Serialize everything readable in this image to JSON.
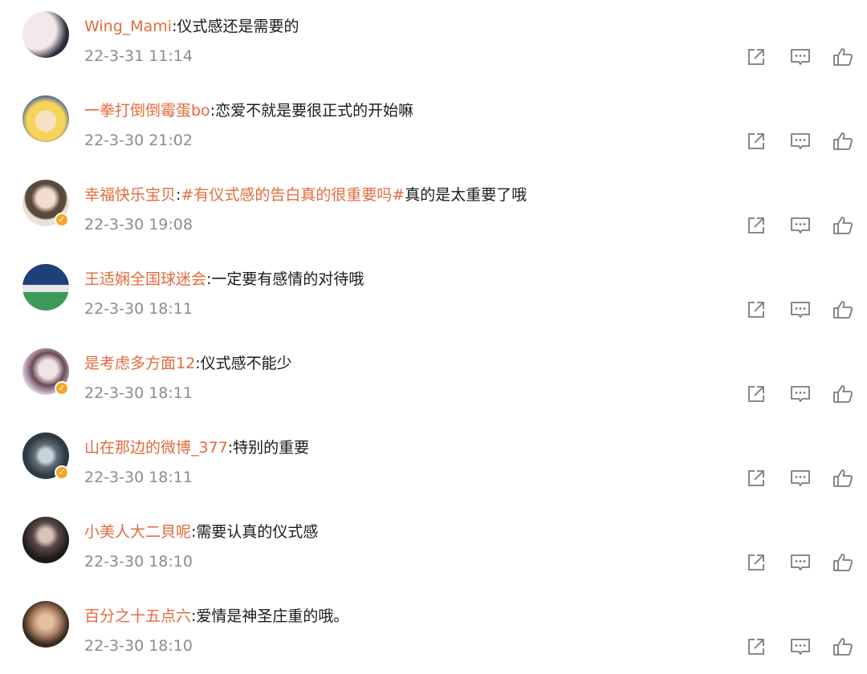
{
  "comments": [
    {
      "username": "Wing_Mami",
      "separator": ":",
      "hashtag": "",
      "text": "仪式感还是需要的",
      "timestamp": "22-3-31 11:14",
      "verified": false,
      "avatar_colors": [
        "#f3e9ea",
        "#2b2d3a"
      ]
    },
    {
      "username": "一拳打倒倒霉蛋bo",
      "separator": ":",
      "hashtag": "",
      "text": "恋爱不就是要很正式的开始嘛",
      "timestamp": "22-3-30 21:02",
      "verified": false,
      "avatar_colors": [
        "#f6d35a",
        "#3a5aa8"
      ]
    },
    {
      "username": "幸福快乐宝贝",
      "separator": ":",
      "hashtag": "#有仪式感的告白真的很重要吗#",
      "text": "真的是太重要了哦",
      "timestamp": "22-3-30 19:08",
      "verified": true,
      "avatar_colors": [
        "#e8e2d6",
        "#5a4a3c"
      ]
    },
    {
      "username": "王适娴全国球迷会",
      "separator": ":",
      "hashtag": "",
      "text": "一定要有感情的对待哦",
      "timestamp": "22-3-30 18:11",
      "verified": false,
      "avatar_colors": [
        "#3e9a5a",
        "#1f3f7a"
      ]
    },
    {
      "username": "是考虑多方面12",
      "separator": ":",
      "hashtag": "",
      "text": "仪式感不能少",
      "timestamp": "22-3-30 18:11",
      "verified": true,
      "avatar_colors": [
        "#d8c8d6",
        "#6b4a5a"
      ]
    },
    {
      "username": "山在那边的微博_377",
      "separator": ":",
      "hashtag": "",
      "text": "特别的重要",
      "timestamp": "22-3-30 18:11",
      "verified": true,
      "avatar_colors": [
        "#2e3a44",
        "#c9d3da"
      ]
    },
    {
      "username": "小美人大二貝呢",
      "separator": ":",
      "hashtag": "",
      "text": "需要认真的仪式感",
      "timestamp": "22-3-30 18:10",
      "verified": false,
      "avatar_colors": [
        "#5a4848",
        "#1e1a1a"
      ]
    },
    {
      "username": "百分之十五点六",
      "separator": ":",
      "hashtag": "",
      "text": "爱情是神圣庄重的哦。",
      "timestamp": "22-3-30 18:10",
      "verified": false,
      "avatar_colors": [
        "#b88a6a",
        "#3a2a20"
      ]
    }
  ],
  "icons": {
    "share": "share-icon",
    "comment": "comment-icon",
    "like": "thumbs-up-icon",
    "verified": "verified-icon"
  },
  "colors": {
    "username": "#e36b3c",
    "text": "#1a1a1a",
    "timestamp": "#8c8c8c",
    "icon": "#7a7a7a",
    "verified": "#f5a623"
  }
}
